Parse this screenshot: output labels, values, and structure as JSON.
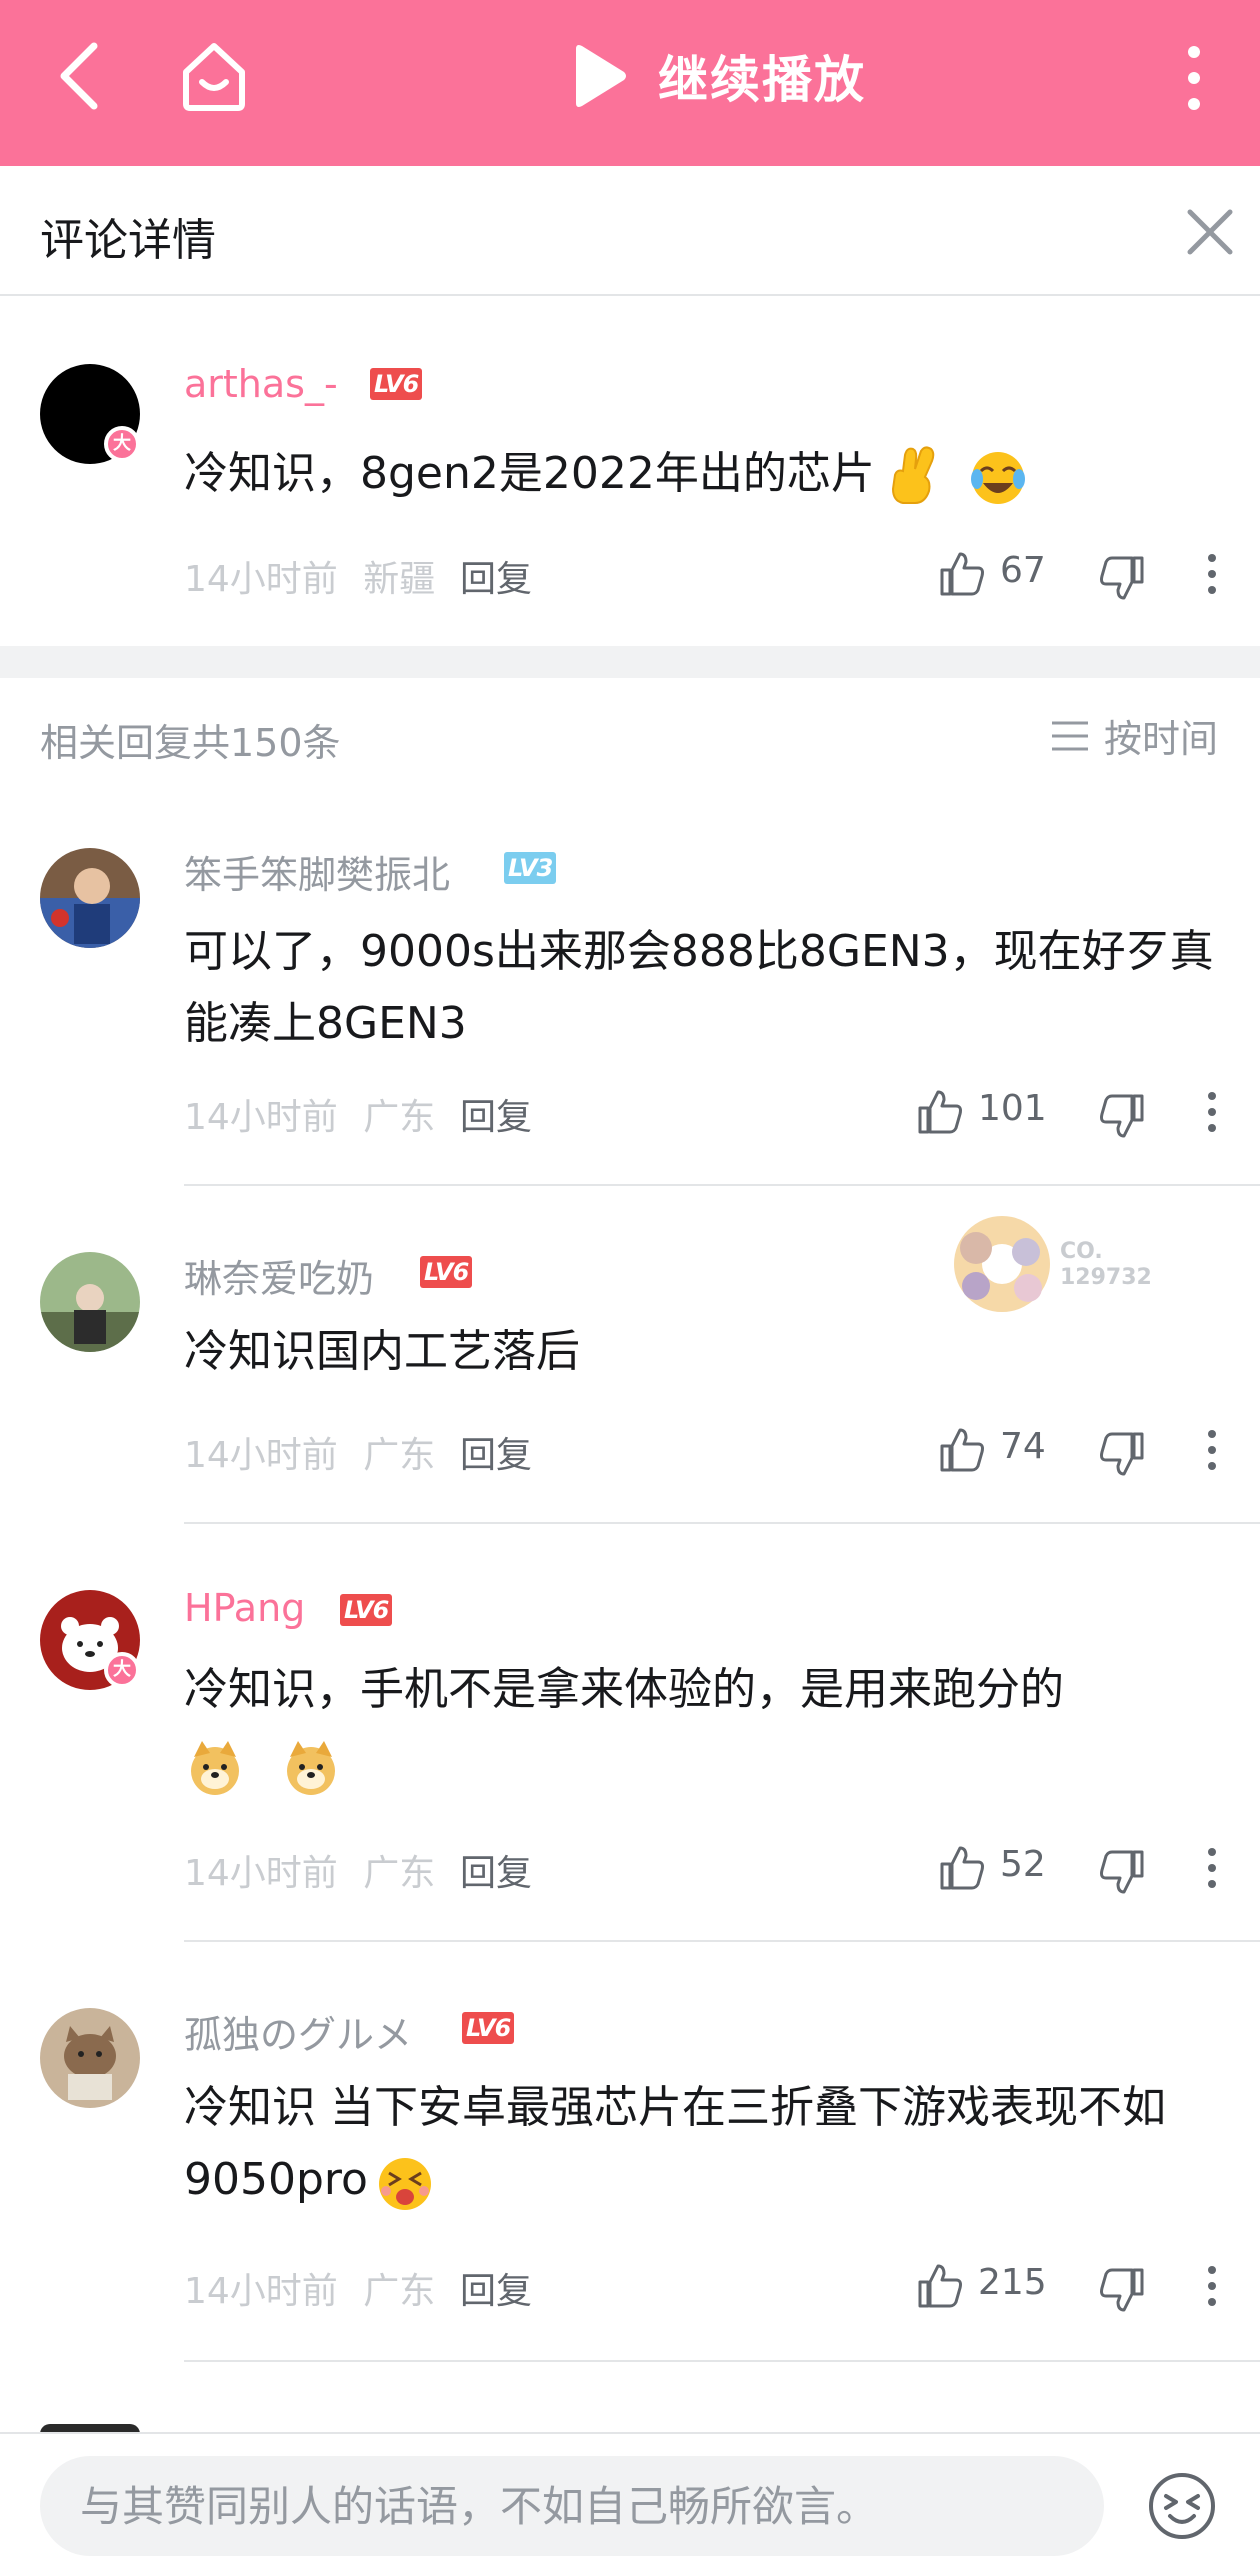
{
  "topbar": {
    "play_label": "继续播放"
  },
  "detail_header": {
    "title": "评论详情"
  },
  "main_comment": {
    "username": "arthas_-",
    "level": "LV6",
    "text": "冷知识，8gen2是2022年出的芯片",
    "time": "14小时前",
    "location": "新疆",
    "reply_label": "回复",
    "likes": "67"
  },
  "replies_header": {
    "count_text": "相关回复共150条",
    "sort_label": "按时间"
  },
  "replies": [
    {
      "username": "笨手笨脚樊振北",
      "level": "LV3",
      "text": "可以了，9000s出来那会888比8GEN3，现在好歹真能凑上8GEN3",
      "time": "14小时前",
      "location": "广东",
      "reply_label": "回复",
      "likes": "101"
    },
    {
      "username": "琳奈爱吃奶",
      "level": "LV6",
      "text": "冷知识国内工艺落后",
      "time": "14小时前",
      "location": "广东",
      "reply_label": "回复",
      "likes": "74",
      "fan_badge_text": "CO.\n129732"
    },
    {
      "username": "HPang",
      "level": "LV6",
      "text": "冷知识，手机不是拿来体验的，是用来跑分的",
      "time": "14小时前",
      "location": "广东",
      "reply_label": "回复",
      "likes": "52"
    },
    {
      "username": "孤独のグルメ",
      "level": "LV6",
      "text": "冷知识 当下安卓最强芯片在三折叠下游戏表现不如9050pro",
      "time": "14小时前",
      "location": "广东",
      "reply_label": "回复",
      "likes": "215"
    }
  ],
  "bottom_bar": {
    "placeholder": "与其赞同别人的话语，不如自己畅所欲言。"
  },
  "colors": {
    "brand_pink": "#fb7299",
    "level6_red": "#ee4d4d",
    "level3_blue": "#7bcdef",
    "meta_gray": "#c9ccd0"
  }
}
